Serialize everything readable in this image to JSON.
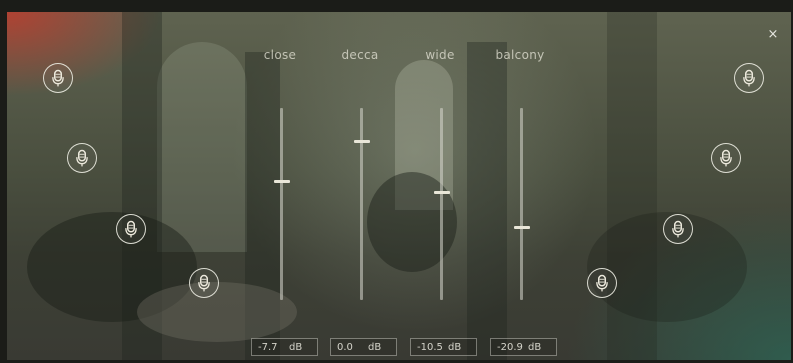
{
  "window": {
    "close_glyph": "×"
  },
  "channels": [
    {
      "label": "close",
      "value": "-7.7",
      "unit": "dB",
      "level": 0.62
    },
    {
      "label": "decca",
      "value": "0.0",
      "unit": "dB",
      "level": 0.83
    },
    {
      "label": "wide",
      "value": "-10.5",
      "unit": "dB",
      "level": 0.56
    },
    {
      "label": "balcony",
      "value": "-20.9",
      "unit": "dB",
      "level": 0.38
    }
  ],
  "microphones": [
    {
      "name": "mic-1",
      "icon": "microphone-icon"
    },
    {
      "name": "mic-2",
      "icon": "microphone-icon"
    },
    {
      "name": "mic-3",
      "icon": "microphone-icon"
    },
    {
      "name": "mic-4",
      "icon": "microphone-icon"
    },
    {
      "name": "mic-5",
      "icon": "microphone-icon"
    },
    {
      "name": "mic-6",
      "icon": "microphone-icon"
    },
    {
      "name": "mic-7",
      "icon": "microphone-icon"
    },
    {
      "name": "mic-8",
      "icon": "microphone-icon"
    }
  ],
  "colors": {
    "ui_line": "#e9e6d8",
    "accent_red": "#be3c2d",
    "accent_teal": "#28786a"
  }
}
